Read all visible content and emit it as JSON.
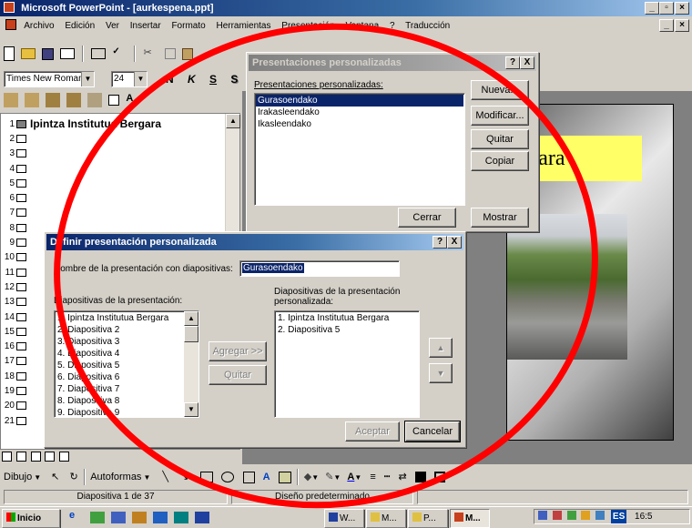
{
  "app": {
    "title": "Microsoft PowerPoint - [aurkespena.ppt]",
    "menu": [
      "Archivo",
      "Edición",
      "Ver",
      "Insertar",
      "Formato",
      "Herramientas",
      "Presentación",
      "Ventana",
      "?",
      "Traducción"
    ]
  },
  "format_bar": {
    "font": "Times New Roman",
    "size": "24",
    "bold": "N",
    "italic": "K",
    "underline": "S",
    "shadow": "S"
  },
  "outline": {
    "slide1_title": "Ipintza Institutua Bergara",
    "numbers": [
      "1",
      "2",
      "3",
      "4",
      "5",
      "6",
      "7",
      "8",
      "9",
      "10",
      "11",
      "12",
      "13",
      "14",
      "15",
      "16",
      "17",
      "18",
      "19",
      "20",
      "21"
    ]
  },
  "slide_preview": {
    "title_fragment": "ergara"
  },
  "custom_shows_dialog": {
    "title": "Presentaciones personalizadas",
    "list_label": "Presentaciones personalizadas:",
    "items": [
      "Gurasoendako",
      "Irakasleendako",
      "Ikasleendako"
    ],
    "selected_index": 0,
    "buttons": {
      "new": "Nueva...",
      "edit": "Modificar...",
      "remove": "Quitar",
      "copy": "Copiar",
      "close": "Cerrar",
      "show": "Mostrar"
    },
    "help": "?",
    "close_x": "X"
  },
  "define_dialog": {
    "title": "Definir presentación personalizada",
    "name_label": "Nombre de la presentación con diapositivas:",
    "name_value": "Gurasoendako",
    "left_label": "Diapositivas de la presentación:",
    "left_items": [
      "1. Ipintza Institutua Bergara",
      "2. Diapositiva 2",
      "3. Diapositiva 3",
      "4. Diapositiva 4",
      "5. Diapositiva 5",
      "6. Diapositiva 6",
      "7. Diapositiva 7",
      "8. Diapositiva 8",
      "9. Diapositiva 9"
    ],
    "right_label_1": "Diapositivas de la presentación",
    "right_label_2": "personalizada:",
    "right_items": [
      "1. Ipintza Institutua Bergara",
      "2. Diapositiva 5"
    ],
    "add": "Agregar >>",
    "remove": "Quitar",
    "ok": "Aceptar",
    "cancel": "Cancelar",
    "help": "?",
    "close_x": "X"
  },
  "drawing_bar": {
    "draw": "Dibujo",
    "autoshapes": "Autoformas"
  },
  "status": {
    "slide": "Diapositiva 1 de 37",
    "design": "Diseño predeterminado"
  },
  "taskbar": {
    "start": "Inicio",
    "tasks": [
      "W...",
      "M...",
      "P...",
      "M..."
    ],
    "clock": "16:5",
    "tray": "ES"
  },
  "colors": {
    "titlebar": "#0a246a",
    "selection": "#0a246a",
    "annotation": "#ff0000",
    "slide_title_bg": "#ffff66"
  }
}
